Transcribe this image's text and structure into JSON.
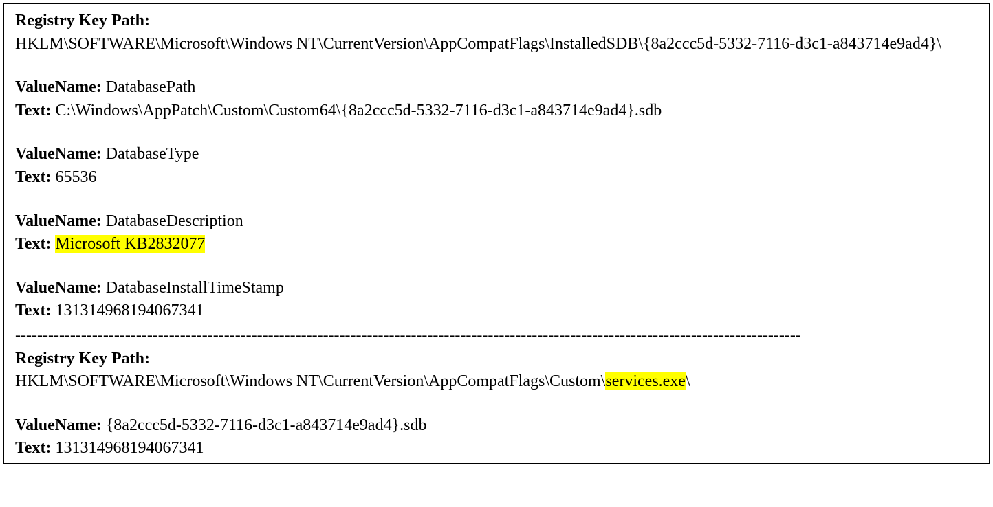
{
  "section1": {
    "registry_key_path_label": "Registry Key Path:",
    "registry_key_path_value": "HKLM\\SOFTWARE\\Microsoft\\Windows NT\\CurrentVersion\\AppCompatFlags\\InstalledSDB\\{8a2ccc5d-5332-7116-d3c1-a843714e9ad4}\\",
    "entries": [
      {
        "valuename_label": "ValueName:",
        "valuename_value": "DatabasePath",
        "text_label": "Text:",
        "text_value": "C:\\Windows\\AppPatch\\Custom\\Custom64\\{8a2ccc5d-5332-7116-d3c1-a843714e9ad4}.sdb",
        "highlight": false
      },
      {
        "valuename_label": "ValueName:",
        "valuename_value": "DatabaseType",
        "text_label": "Text:",
        "text_value": "65536",
        "highlight": false
      },
      {
        "valuename_label": "ValueName:",
        "valuename_value": "DatabaseDescription",
        "text_label": "Text:",
        "text_value": "Microsoft KB2832077",
        "highlight": true
      },
      {
        "valuename_label": "ValueName:",
        "valuename_value": "DatabaseInstallTimeStamp",
        "text_label": "Text:",
        "text_value": "131314968194067341",
        "highlight": false
      }
    ]
  },
  "separator": "-----------------------------------------------------------------------------------------------------------------------------------------------",
  "section2": {
    "registry_key_path_label": "Registry Key Path:",
    "registry_key_path_prefix": "HKLM\\SOFTWARE\\Microsoft\\Windows NT\\CurrentVersion\\AppCompatFlags\\Custom\\",
    "registry_key_path_highlight": "services.exe",
    "registry_key_path_suffix": "\\",
    "entries": [
      {
        "valuename_label": "ValueName:",
        "valuename_value": "{8a2ccc5d-5332-7116-d3c1-a843714e9ad4}.sdb",
        "text_label": "Text:",
        "text_value": "131314968194067341",
        "highlight": false
      }
    ]
  }
}
